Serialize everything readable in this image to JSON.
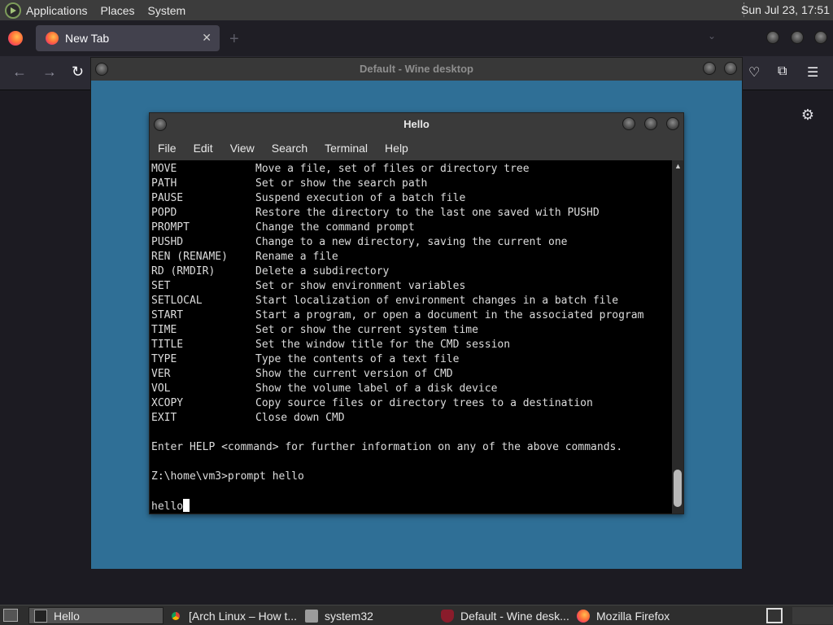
{
  "top_panel": {
    "menus": [
      "Applications",
      "Places",
      "System"
    ],
    "clock": "Sun Jul 23, 17:51"
  },
  "firefox": {
    "tab_title": "New Tab",
    "close_glyph": "✕",
    "new_tab_glyph": "+",
    "back_glyph": "←",
    "forward_glyph": "→",
    "reload_glyph": "↻",
    "settings_glyph": "⚙",
    "pocket_glyph": "♡",
    "extensions_glyph": "⧉",
    "menu_glyph": "☰",
    "tablist_glyph": "⌄"
  },
  "wine_window": {
    "title": "Default - Wine desktop"
  },
  "terminal": {
    "title": "Hello",
    "menu": [
      "File",
      "Edit",
      "View",
      "Search",
      "Terminal",
      "Help"
    ],
    "commands": [
      {
        "cmd": "MOVE",
        "desc": "Move a file, set of files or directory tree"
      },
      {
        "cmd": "PATH",
        "desc": "Set or show the search path"
      },
      {
        "cmd": "PAUSE",
        "desc": "Suspend execution of a batch file"
      },
      {
        "cmd": "POPD",
        "desc": "Restore the directory to the last one saved with PUSHD"
      },
      {
        "cmd": "PROMPT",
        "desc": "Change the command prompt"
      },
      {
        "cmd": "PUSHD",
        "desc": "Change to a new directory, saving the current one"
      },
      {
        "cmd": "REN (RENAME)",
        "desc": "Rename a file"
      },
      {
        "cmd": "RD (RMDIR)",
        "desc": "Delete a subdirectory"
      },
      {
        "cmd": "SET",
        "desc": "Set or show environment variables"
      },
      {
        "cmd": "SETLOCAL",
        "desc": "Start localization of environment changes in a batch file"
      },
      {
        "cmd": "START",
        "desc": "Start a program, or open a document in the associated program"
      },
      {
        "cmd": "TIME",
        "desc": "Set or show the current system time"
      },
      {
        "cmd": "TITLE",
        "desc": "Set the window title for the CMD session"
      },
      {
        "cmd": "TYPE",
        "desc": "Type the contents of a text file"
      },
      {
        "cmd": "VER",
        "desc": "Show the current version of CMD"
      },
      {
        "cmd": "VOL",
        "desc": "Show the volume label of a disk device"
      },
      {
        "cmd": "XCOPY",
        "desc": "Copy source files or directory trees to a destination"
      },
      {
        "cmd": "EXIT",
        "desc": "Close down CMD"
      }
    ],
    "help_line": "Enter HELP <command> for further information on any of the above commands.",
    "prompt_line": "Z:\\home\\vm3>prompt hello",
    "current_prompt": "hello",
    "scroll_up_glyph": "▲"
  },
  "taskbar": {
    "items": [
      {
        "label": "Hello",
        "icon": "terminal-icon"
      },
      {
        "label": "[Arch Linux – How t...",
        "icon": "chrome-icon"
      },
      {
        "label": "system32",
        "icon": "folder-icon"
      },
      {
        "label": "Default - Wine desk...",
        "icon": "wine-icon"
      },
      {
        "label": "Mozilla Firefox",
        "icon": "firefox-icon"
      }
    ]
  }
}
